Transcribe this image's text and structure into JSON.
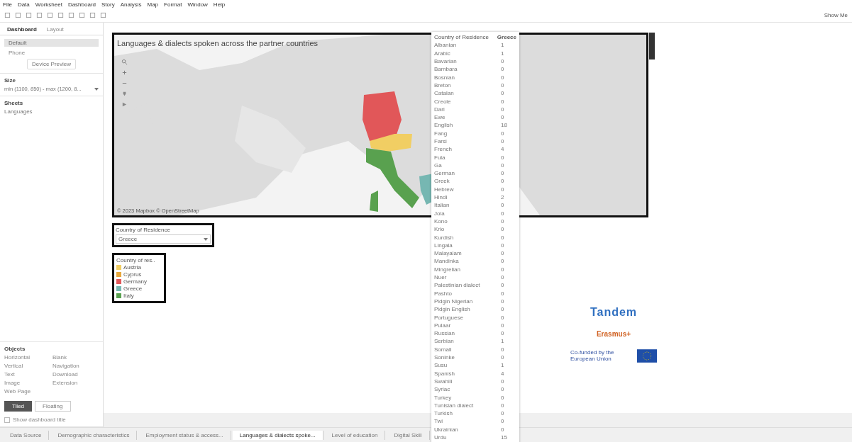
{
  "menu": [
    "File",
    "Data",
    "Worksheet",
    "Dashboard",
    "Story",
    "Analysis",
    "Map",
    "Format",
    "Window",
    "Help"
  ],
  "show_me": "Show Me",
  "side_tabs": [
    {
      "label": "Dashboard",
      "selected": true
    },
    {
      "label": "Layout",
      "selected": false
    }
  ],
  "devices": [
    {
      "label": "Default",
      "selected": true
    },
    {
      "label": "Phone",
      "selected": false
    }
  ],
  "device_preview": "Device Preview",
  "size": {
    "title": "Size",
    "value": "min (1100, 850) - max (1200, 8..."
  },
  "sheets": {
    "title": "Sheets",
    "items": [
      "Languages"
    ]
  },
  "objects": {
    "title": "Objects",
    "items": [
      "Horizontal",
      "Blank",
      "Vertical",
      "Navigation",
      "Text",
      "Download",
      "Image",
      "Extension",
      "Web Page"
    ]
  },
  "layout_mode": [
    {
      "label": "Tiled",
      "selected": true
    },
    {
      "label": "Floating",
      "selected": false
    }
  ],
  "show_title": {
    "label": "Show dashboard title",
    "checked": false
  },
  "map": {
    "title": "Languages & dialects spoken across the partner countries",
    "attribution": "© 2023 Mapbox © OpenStreetMap"
  },
  "filter": {
    "title": "Country of Residence",
    "value": "Greece"
  },
  "legend": {
    "title": "Country of res..",
    "items": [
      {
        "label": "Austria",
        "color": "#f1ce63"
      },
      {
        "label": "Cyprus",
        "color": "#e7a83c"
      },
      {
        "label": "Germany",
        "color": "#e15759"
      },
      {
        "label": "Greece",
        "color": "#76b7b2"
      },
      {
        "label": "Italy",
        "color": "#59a14f"
      }
    ]
  },
  "tooltip": {
    "columns": [
      "Country of Residence",
      "Greece"
    ],
    "rows": [
      [
        "Albanian",
        "1"
      ],
      [
        "Arabic",
        "1"
      ],
      [
        "Bavarian",
        "0"
      ],
      [
        "Bambara",
        "0"
      ],
      [
        "Bosnian",
        "0"
      ],
      [
        "Breton",
        "0"
      ],
      [
        "Catalan",
        "0"
      ],
      [
        "Creole",
        "0"
      ],
      [
        "Dari",
        "0"
      ],
      [
        "Ewe",
        "0"
      ],
      [
        "English",
        "18"
      ],
      [
        "Fang",
        "0"
      ],
      [
        "Farsi",
        "0"
      ],
      [
        "French",
        "4"
      ],
      [
        "Fula",
        "0"
      ],
      [
        "Ga",
        "0"
      ],
      [
        "German",
        "0"
      ],
      [
        "Greek",
        "0"
      ],
      [
        "Hebrew",
        "0"
      ],
      [
        "Hindi",
        "2"
      ],
      [
        "Italian",
        "0"
      ],
      [
        "Jola",
        "0"
      ],
      [
        "Kono",
        "0"
      ],
      [
        "Krio",
        "0"
      ],
      [
        "Kurdish",
        "0"
      ],
      [
        "Lingala",
        "0"
      ],
      [
        "Malayalam",
        "0"
      ],
      [
        "Mandinka",
        "0"
      ],
      [
        "Mingrelian",
        "0"
      ],
      [
        "Nuer",
        "0"
      ],
      [
        "Palestinian dialect",
        "0"
      ],
      [
        "Pashto",
        "0"
      ],
      [
        "Pidgin Nigerian",
        "0"
      ],
      [
        "Pidgin English",
        "0"
      ],
      [
        "Portuguese",
        "0"
      ],
      [
        "Pulaar",
        "0"
      ],
      [
        "Russian",
        "0"
      ],
      [
        "Serbian",
        "1"
      ],
      [
        "Somali",
        "0"
      ],
      [
        "Soninke",
        "0"
      ],
      [
        "Susu",
        "1"
      ],
      [
        "Spanish",
        "4"
      ],
      [
        "Swahili",
        "0"
      ],
      [
        "Syriac",
        "0"
      ],
      [
        "Turkey",
        "0"
      ],
      [
        "Tunisian dialect",
        "0"
      ],
      [
        "Turkish",
        "0"
      ],
      [
        "Twi",
        "0"
      ],
      [
        "Ukrainian",
        "0"
      ],
      [
        "Urdu",
        "15"
      ]
    ]
  },
  "logos": {
    "tandem": "Tandem",
    "erasmus": "Erasmus+",
    "eu": "Co-funded by the European Union"
  },
  "sheet_tabs": [
    {
      "label": "Data Source",
      "selected": false
    },
    {
      "label": "Demographic characteristics",
      "selected": false
    },
    {
      "label": "Employment status & access...",
      "selected": false
    },
    {
      "label": "Languages & dialects spoke...",
      "selected": true
    },
    {
      "label": "Level of education",
      "selected": false
    },
    {
      "label": "Digital Skill",
      "selected": false
    }
  ]
}
